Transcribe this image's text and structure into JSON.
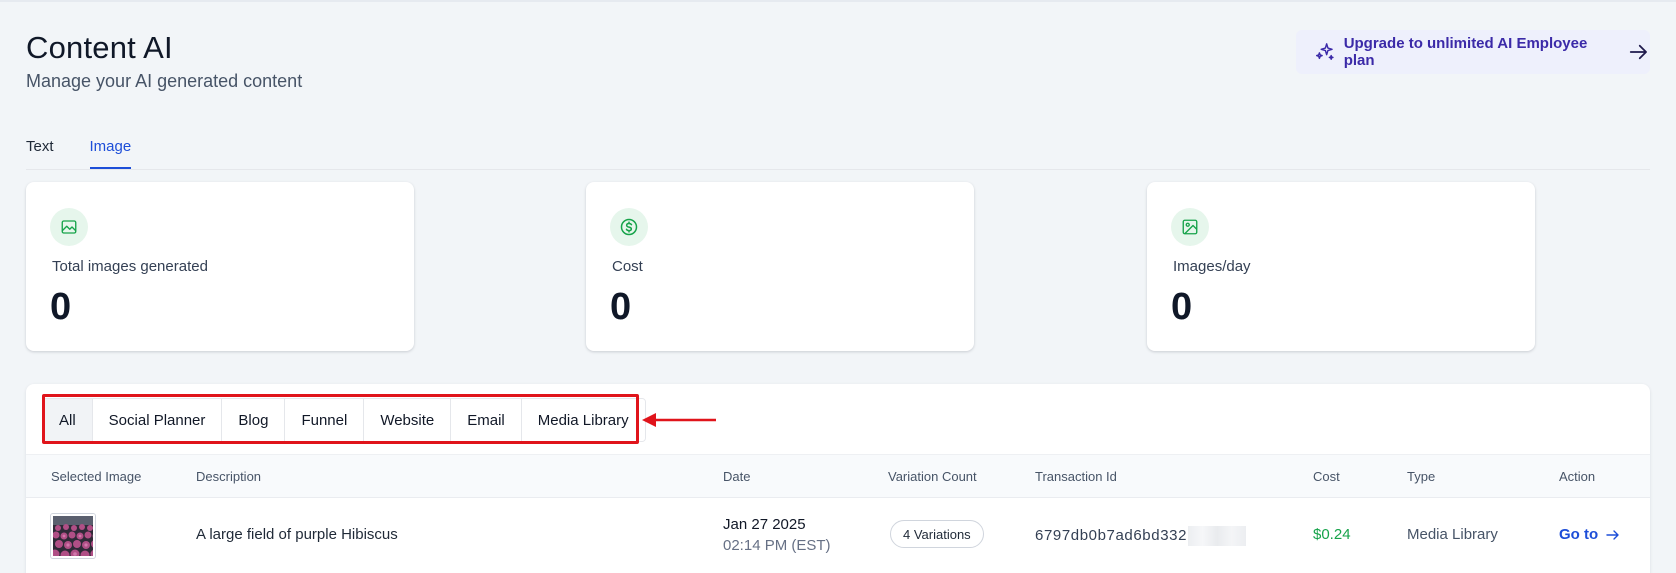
{
  "header": {
    "title": "Content AI",
    "subtitle": "Manage your AI generated content",
    "upgrade_label": "Upgrade to unlimited AI Employee plan"
  },
  "tabs": [
    {
      "label": "Text",
      "active": false
    },
    {
      "label": "Image",
      "active": true
    }
  ],
  "stats": [
    {
      "icon": "image-landscape-icon",
      "label": "Total images generated",
      "value": "0"
    },
    {
      "icon": "dollar-circle-icon",
      "label": "Cost",
      "value": "0"
    },
    {
      "icon": "image-frame-icon",
      "label": "Images/day",
      "value": "0"
    }
  ],
  "filters": [
    {
      "label": "All",
      "active": true
    },
    {
      "label": "Social Planner",
      "active": false
    },
    {
      "label": "Blog",
      "active": false
    },
    {
      "label": "Funnel",
      "active": false
    },
    {
      "label": "Website",
      "active": false
    },
    {
      "label": "Email",
      "active": false
    },
    {
      "label": "Media Library",
      "active": false
    }
  ],
  "table": {
    "columns": [
      "Selected Image",
      "Description",
      "Date",
      "Variation Count",
      "Transaction Id",
      "Cost",
      "Type",
      "Action"
    ],
    "rows": [
      {
        "description": "A large field of purple Hibiscus",
        "date": "Jan 27 2025",
        "time": "02:14 PM (EST)",
        "variations": "4 Variations",
        "transaction_id": "6797db0b7ad6bd332",
        "cost": "$0.24",
        "type": "Media Library",
        "action": "Go to"
      }
    ]
  },
  "colors": {
    "accent": "#1d4ed8",
    "upgrade_text": "#3b2aa8",
    "icon_green": "#16a34a",
    "annotation_red": "#e0141b"
  }
}
